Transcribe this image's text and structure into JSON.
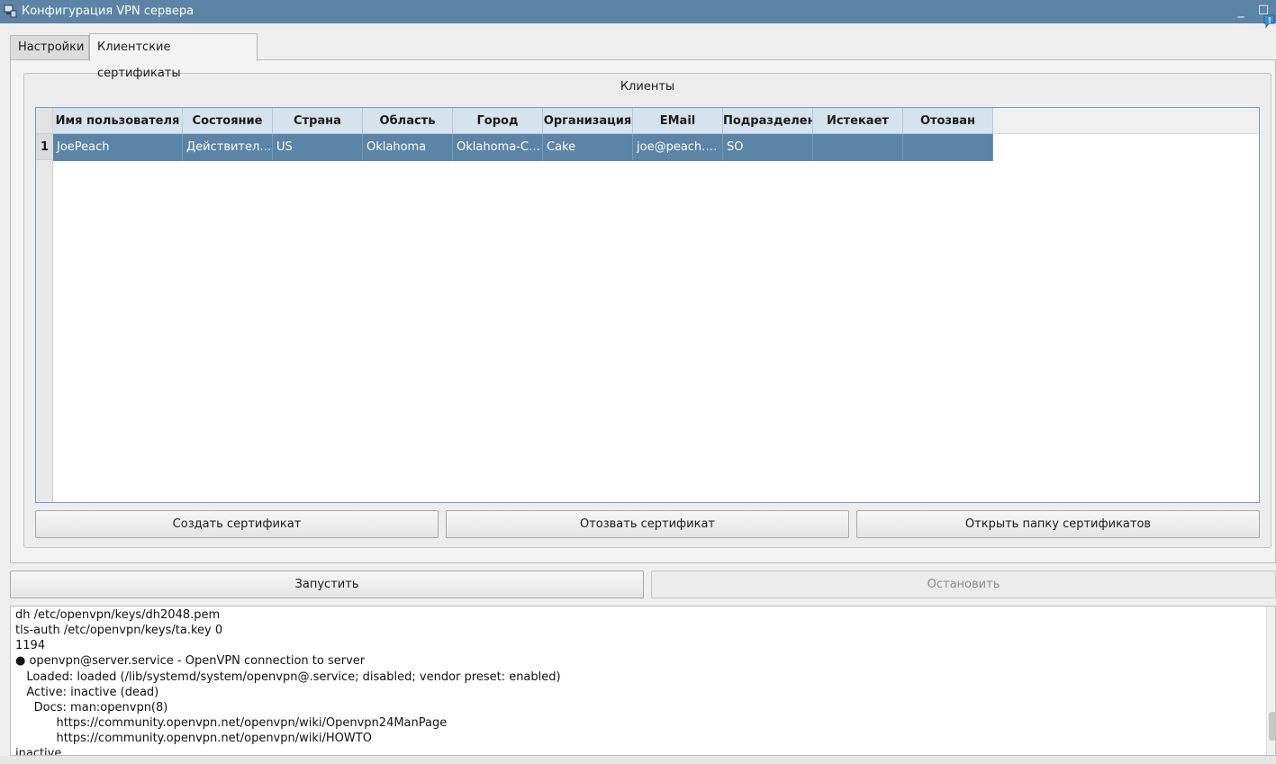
{
  "window": {
    "title": "Конфигурация VPN сервера",
    "minimize": "_",
    "maximize": "☐"
  },
  "tabs": [
    {
      "label": "Настройки",
      "active": false
    },
    {
      "label": "Клиентские сертификаты",
      "active": true
    }
  ],
  "clients_group": {
    "title": "Клиенты",
    "columns": [
      "Имя пользователя",
      "Состояние",
      "Страна",
      "Область",
      "Город",
      "Организация",
      "EMail",
      "Подразделение",
      "Истекает",
      "Отозван"
    ],
    "rows": [
      {
        "num": "1",
        "cells": [
          "JoePeach",
          "Действительный",
          "US",
          "Oklahoma",
          "Oklahoma-City",
          "Cake",
          "joe@peach.com",
          "SO",
          "",
          ""
        ]
      }
    ],
    "buttons": {
      "create": "Создать сертификат",
      "revoke": "Отозвать сертификат",
      "open_folder": "Открыть папку сертификатов"
    }
  },
  "controls": {
    "start": "Запустить",
    "stop": "Остановить"
  },
  "log": [
    "dh /etc/openvpn/keys/dh2048.pem",
    "tls-auth /etc/openvpn/keys/ta.key 0",
    "1194",
    "● openvpn@server.service - OpenVPN connection to server",
    "   Loaded: loaded (/lib/systemd/system/openvpn@.service; disabled; vendor preset: enabled)",
    "   Active: inactive (dead)",
    "     Docs: man:openvpn(8)",
    "           https://community.openvpn.net/openvpn/wiki/Openvpn24ManPage",
    "           https://community.openvpn.net/openvpn/wiki/HOWTO",
    "inactive"
  ],
  "colors": {
    "titlebar": "#5b84a7",
    "selection": "#5b84a7",
    "header": "#d5e3ee",
    "table_border": "#6d9ec9"
  }
}
